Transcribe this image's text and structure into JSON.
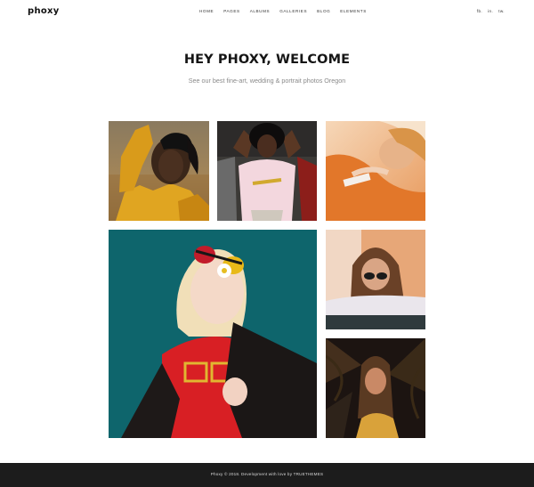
{
  "header": {
    "logo": "phoxy",
    "nav": [
      "HOME",
      "PAGES",
      "ALBUMS",
      "GALLERIES",
      "BLOG",
      "ELEMENTS"
    ],
    "social": [
      "fb.",
      "in.",
      "tw."
    ]
  },
  "hero": {
    "title": "HEY PHOXY, WELCOME",
    "subtitle": "See our best fine-art, wedding & portrait photos Oregon"
  },
  "gallery": {
    "photos": [
      "man-yellow-jacket-photo",
      "woman-pink-tshirt-photo",
      "woman-orange-reclining-photo",
      "woman-red-heart-sunglasses-photo",
      "woman-sunglasses-resting-photo",
      "woman-palm-leaves-photo"
    ]
  },
  "footer": {
    "text": "Phoxy © 2018. Development with love by TRUETHEMES"
  }
}
